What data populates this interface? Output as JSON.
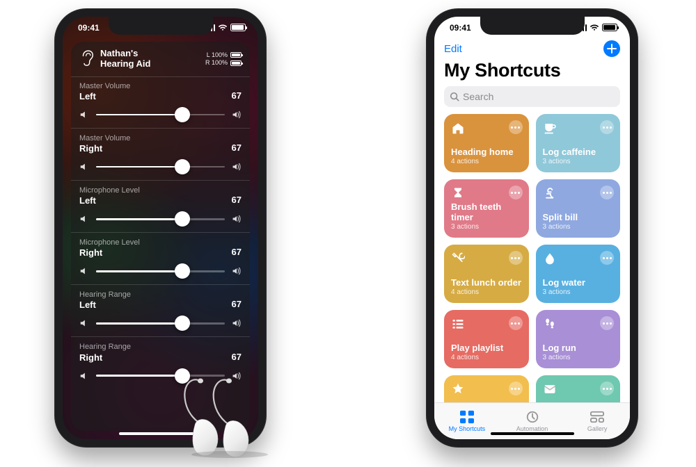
{
  "phone1": {
    "time": "09:41",
    "device_line1": "Nathan's",
    "device_line2": "Hearing Aid",
    "battery_left_label": "L 100%",
    "battery_right_label": "R 100%",
    "sliders": [
      {
        "label": "Master Volume",
        "side": "Left",
        "value": "67",
        "pct": 67
      },
      {
        "label": "Master Volume",
        "side": "Right",
        "value": "67",
        "pct": 67
      },
      {
        "label": "Microphone Level",
        "side": "Left",
        "value": "67",
        "pct": 67
      },
      {
        "label": "Microphone Level",
        "side": "Right",
        "value": "67",
        "pct": 67
      },
      {
        "label": "Hearing Range",
        "side": "Left",
        "value": "67",
        "pct": 67
      },
      {
        "label": "Hearing Range",
        "side": "Right",
        "value": "67",
        "pct": 67
      }
    ]
  },
  "phone2": {
    "time": "09:41",
    "edit_label": "Edit",
    "title": "My Shortcuts",
    "search_placeholder": "Search",
    "tiles": [
      {
        "name": "Heading home",
        "sub": "4 actions",
        "icon": "home-icon",
        "color": "#d9933d"
      },
      {
        "name": "Log caffeine",
        "sub": "3 actions",
        "icon": "cup-icon",
        "color": "#8fc8d9"
      },
      {
        "name": "Brush teeth timer",
        "sub": "3 actions",
        "icon": "hourglass-icon",
        "color": "#e07a88"
      },
      {
        "name": "Split bill",
        "sub": "3 actions",
        "icon": "pound-icon",
        "color": "#8fa8e0"
      },
      {
        "name": "Text lunch order",
        "sub": "4 actions",
        "icon": "utensils-icon",
        "color": "#d6ab44"
      },
      {
        "name": "Log water",
        "sub": "3 actions",
        "icon": "drop-icon",
        "color": "#58b0e0"
      },
      {
        "name": "Play playlist",
        "sub": "4 actions",
        "icon": "list-icon",
        "color": "#e66b63"
      },
      {
        "name": "Log run",
        "sub": "3 actions",
        "icon": "steps-icon",
        "color": "#a98fd6"
      },
      {
        "name": "",
        "sub": "",
        "icon": "star-icon",
        "color": "#f2be4e"
      },
      {
        "name": "",
        "sub": "",
        "icon": "mail-icon",
        "color": "#6fc8b0"
      }
    ],
    "tabs": {
      "shortcuts": "My Shortcuts",
      "automation": "Automation",
      "gallery": "Gallery"
    }
  }
}
